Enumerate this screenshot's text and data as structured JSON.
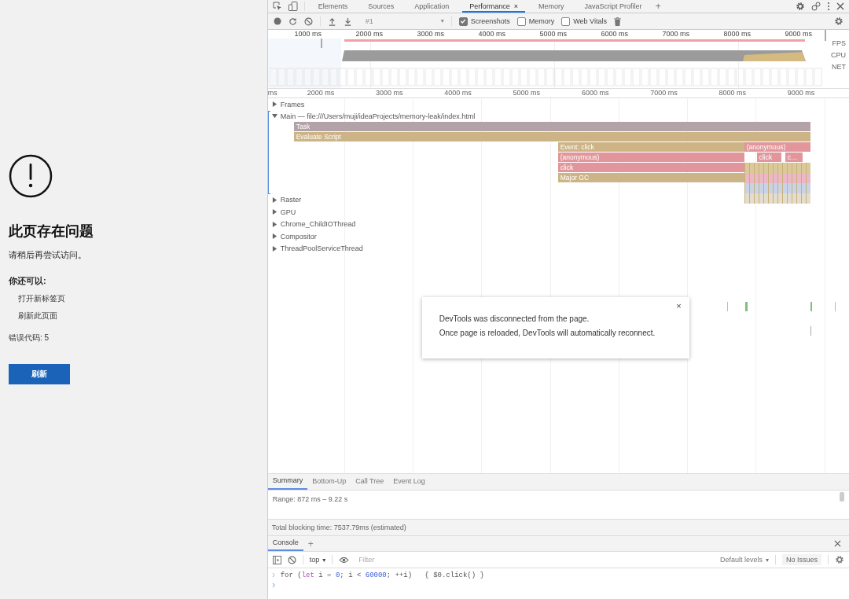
{
  "error_page": {
    "title": "此页存在问题",
    "message": "请稍后再尝试访问。",
    "options_heading": "你还可以:",
    "options": [
      "打开新标签页",
      "刷新此页面"
    ],
    "error_code": "错误代码: 5",
    "button": "刷新"
  },
  "devtools": {
    "tabs": [
      {
        "label": "Elements",
        "selected": false
      },
      {
        "label": "Sources",
        "selected": false
      },
      {
        "label": "Application",
        "selected": false
      },
      {
        "label": "Performance",
        "selected": true,
        "close": "×"
      },
      {
        "label": "Memory",
        "selected": false
      },
      {
        "label": "JavaScript Profiler",
        "selected": false
      }
    ],
    "new_tab": "+",
    "toolbar": {
      "recording": {
        "value": "#1",
        "caret": "▾",
        "disabled": true
      },
      "checkboxes": [
        {
          "label": "Screenshots",
          "checked": true
        },
        {
          "label": "Memory",
          "checked": false
        },
        {
          "label": "Web Vitals",
          "checked": false
        }
      ]
    },
    "overview": {
      "ruler": [
        "1000 ms",
        "2000 ms",
        "3000 ms",
        "4000 ms",
        "5000 ms",
        "6000 ms",
        "7000 ms",
        "8000 ms",
        "9000 ms"
      ],
      "lanes": [
        "FPS",
        "CPU",
        "NET"
      ]
    },
    "ruler": [
      "ms",
      "2000 ms",
      "3000 ms",
      "4000 ms",
      "5000 ms",
      "6000 ms",
      "7000 ms",
      "8000 ms",
      "9000 ms"
    ],
    "tracks": [
      {
        "label": "Frames",
        "expanded": false
      },
      {
        "label": "Main — file:///Users/muji/ideaProjects/memory-leak/index.html",
        "expanded": true
      },
      {
        "label": "Raster",
        "expanded": false
      },
      {
        "label": "GPU",
        "expanded": false
      },
      {
        "label": "Chrome_ChildIOThread",
        "expanded": false
      },
      {
        "label": "Compositor",
        "expanded": false
      },
      {
        "label": "ThreadPoolServiceThread",
        "expanded": false
      }
    ],
    "flame": [
      {
        "label": "Task",
        "color": "#b3a3a8"
      },
      {
        "label": "Evaluate Script",
        "color": "#cdb487"
      },
      {
        "label": "Event: click",
        "color": "#cdb487"
      },
      {
        "label": "(anonymous)",
        "color": "#e2969b"
      },
      {
        "label": "(anonymous)",
        "color": "#e2969b"
      },
      {
        "label": "click",
        "color": "#e2969b"
      },
      {
        "label": "c…",
        "color": "#e2969b"
      },
      {
        "label": "click",
        "color": "#e2969b"
      },
      {
        "label": "Major GC",
        "color": "#cdb487"
      }
    ],
    "dialog": {
      "lines": [
        "DevTools was disconnected from the page.",
        "Once page is reloaded, DevTools will automatically reconnect."
      ],
      "close": "×"
    },
    "bottom_tabs": [
      {
        "label": "Summary",
        "selected": true
      },
      {
        "label": "Bottom-Up",
        "selected": false
      },
      {
        "label": "Call Tree",
        "selected": false
      },
      {
        "label": "Event Log",
        "selected": false
      }
    ],
    "summary": {
      "range": "Range: 872 ms – 9.22 s"
    },
    "status": "Total blocking time: 7537.79ms (estimated)",
    "console": {
      "tab": "Console",
      "selected": true,
      "add": "+",
      "context": "top",
      "context_caret": "▾",
      "filter_placeholder": "Filter",
      "levels": "Default levels",
      "levels_caret": "▾",
      "issues": "No Issues",
      "input": [
        {
          "kind": "plain",
          "text": "for ("
        },
        {
          "kind": "keyword",
          "text": "let"
        },
        {
          "kind": "plain",
          "text": " i = "
        },
        {
          "kind": "number",
          "text": "0"
        },
        {
          "kind": "plain",
          "text": "; i < "
        },
        {
          "kind": "number",
          "text": "60000"
        },
        {
          "kind": "plain",
          "text": "; ++i)   { $0.click() }"
        }
      ]
    }
  }
}
